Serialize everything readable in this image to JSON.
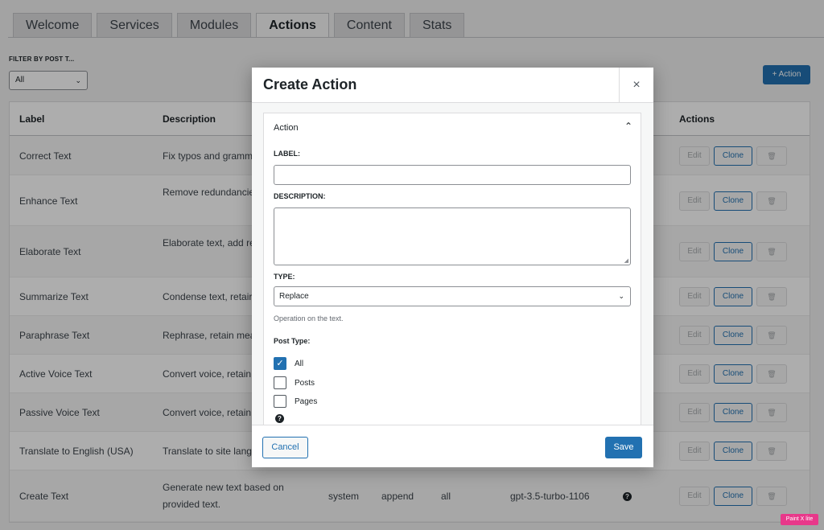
{
  "tabs": [
    {
      "label": "Welcome",
      "active": false
    },
    {
      "label": "Services",
      "active": false
    },
    {
      "label": "Modules",
      "active": false
    },
    {
      "label": "Actions",
      "active": true
    },
    {
      "label": "Content",
      "active": false
    },
    {
      "label": "Stats",
      "active": false
    }
  ],
  "filter": {
    "label": "FILTER BY POST T...",
    "value": "All"
  },
  "add_action_label": "+ Action",
  "table": {
    "headers": {
      "label": "Label",
      "description": "Description",
      "actions": "Actions"
    },
    "rows": [
      {
        "label": "Correct Text",
        "desc": "Fix typos and gramm",
        "edit": "Edit",
        "clone": "Clone"
      },
      {
        "label": "Enhance Text",
        "desc": "Remove redundancie text.",
        "edit": "Edit",
        "clone": "Clone"
      },
      {
        "label": "Elaborate Text",
        "desc": "Elaborate text, add re details.",
        "edit": "Edit",
        "clone": "Clone"
      },
      {
        "label": "Summarize Text",
        "desc": "Condense text, retair",
        "edit": "Edit",
        "clone": "Clone"
      },
      {
        "label": "Paraphrase Text",
        "desc": "Rephrase, retain mea",
        "edit": "Edit",
        "clone": "Clone"
      },
      {
        "label": "Active Voice Text",
        "desc": "Convert voice, retain",
        "edit": "Edit",
        "clone": "Clone"
      },
      {
        "label": "Passive Voice Text",
        "desc": "Convert voice, retain",
        "edit": "Edit",
        "clone": "Clone"
      },
      {
        "label": "Translate to English (USA)",
        "desc": "Translate to site lang",
        "edit": "Edit",
        "clone": "Clone"
      },
      {
        "label": "Create Text",
        "desc": "Generate new text based on provided text.",
        "edit": "Edit",
        "clone": "Clone",
        "extra": {
          "source": "system",
          "type": "append",
          "post_type": "all",
          "model": "gpt-3.5-turbo-1106"
        }
      }
    ]
  },
  "modal": {
    "title": "Create Action",
    "close": "×",
    "panel_title": "Action",
    "label_field": {
      "label": "LABEL:",
      "value": ""
    },
    "description_field": {
      "label": "DESCRIPTION:",
      "value": ""
    },
    "type_field": {
      "label": "TYPE:",
      "value": "Replace",
      "hint": "Operation on the text."
    },
    "post_type": {
      "label": "Post Type:",
      "options": [
        {
          "label": "All",
          "checked": true
        },
        {
          "label": "Posts",
          "checked": false
        },
        {
          "label": "Pages",
          "checked": false
        }
      ]
    },
    "cancel_label": "Cancel",
    "save_label": "Save"
  },
  "badge": "Paint X lite",
  "colors": {
    "primary": "#2271b1",
    "badge": "#e8388a"
  }
}
